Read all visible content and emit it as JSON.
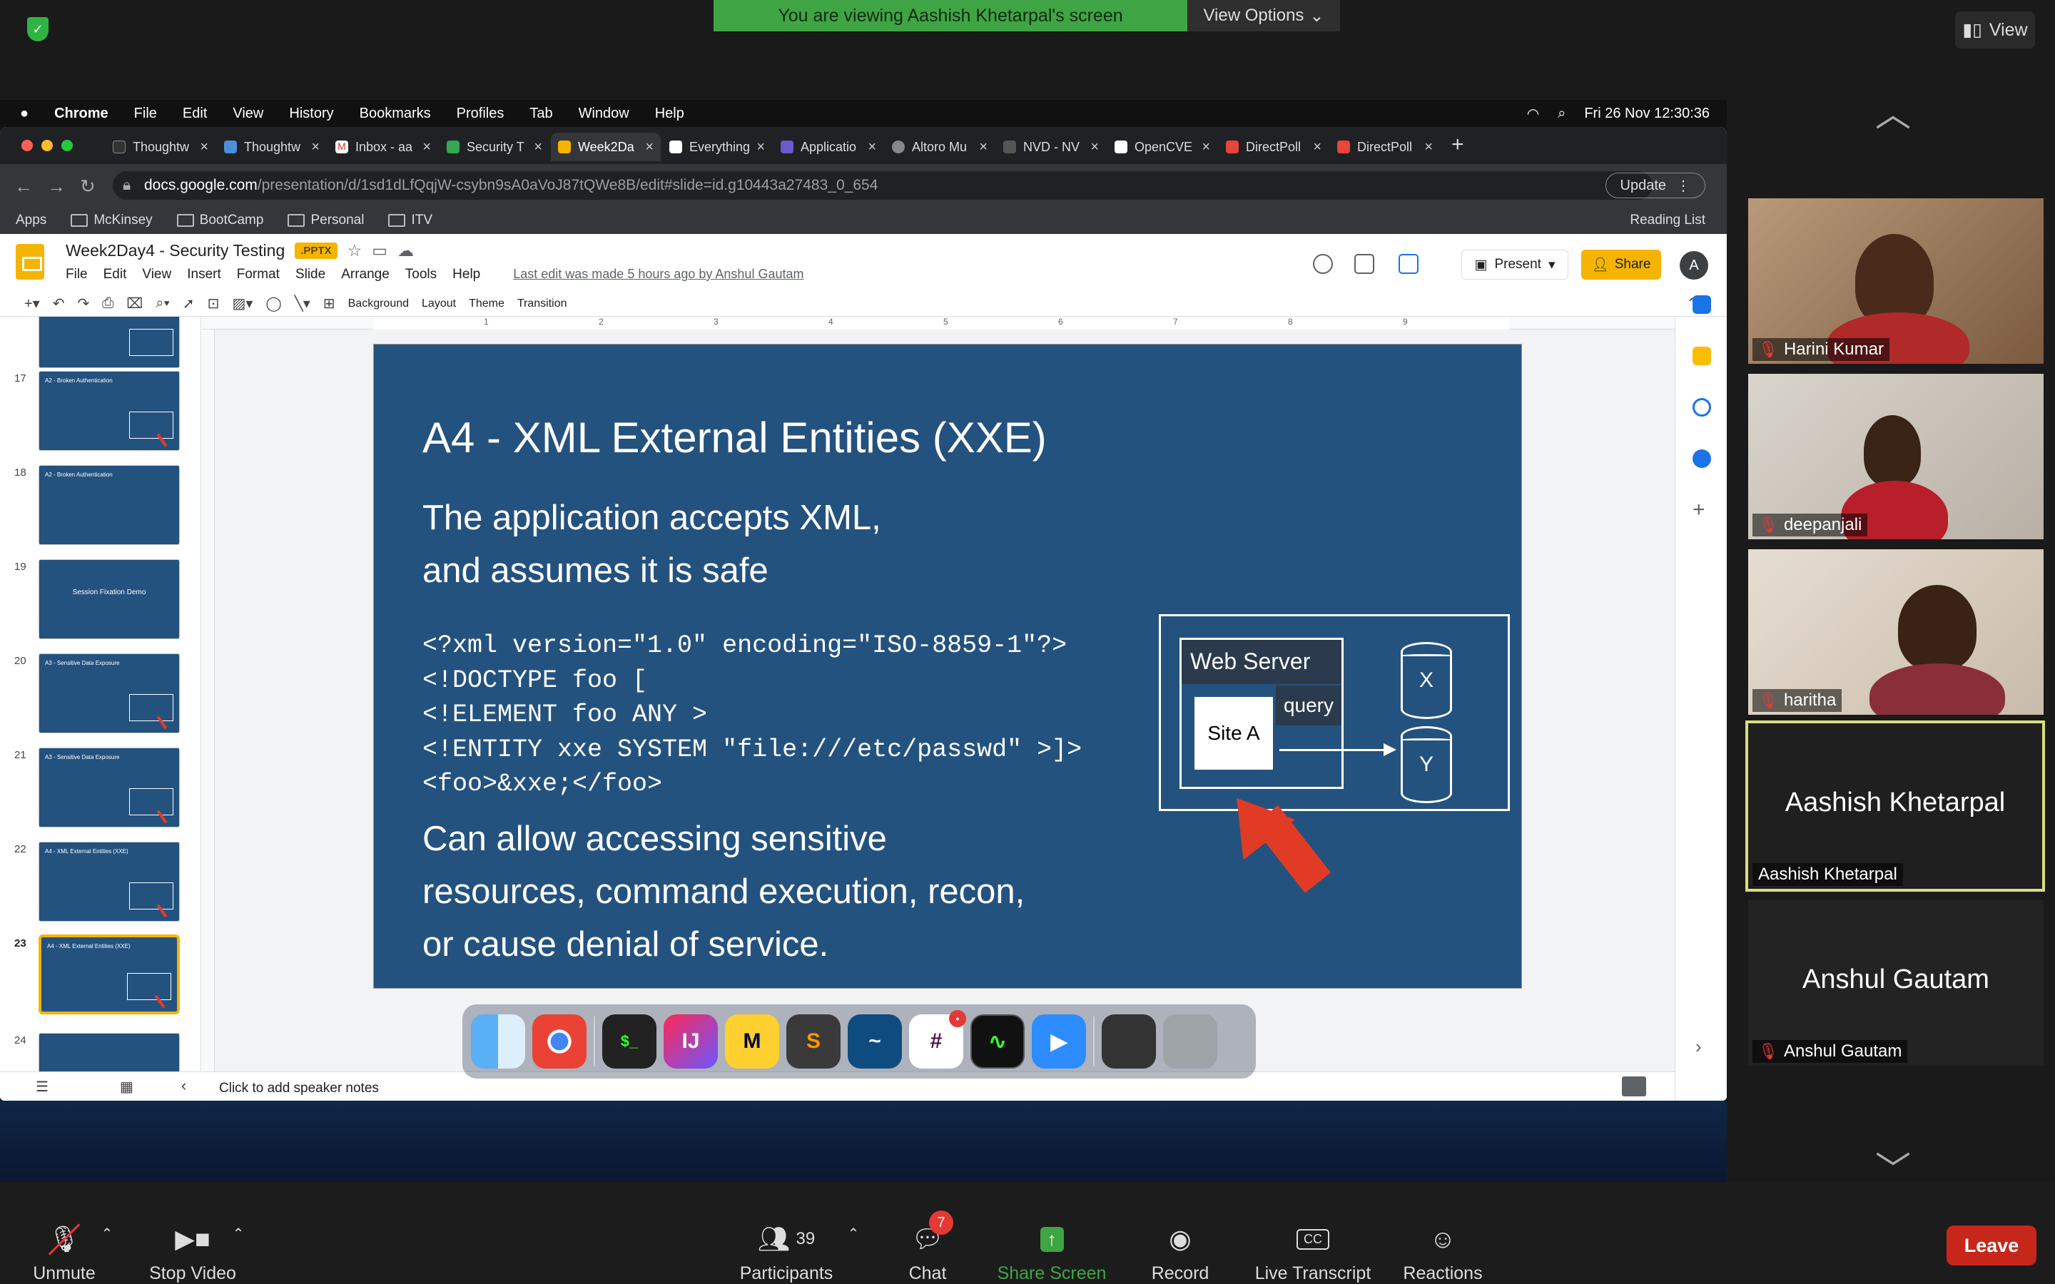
{
  "zoom": {
    "banner": "You are viewing Aashish Khetarpal's screen",
    "view_options": "View Options",
    "view": "View",
    "bottom": {
      "unmute": "Unmute",
      "stop_video": "Stop Video",
      "participants": "Participants",
      "participants_count": "39",
      "chat": "Chat",
      "chat_badge": "7",
      "share_screen": "Share Screen",
      "record": "Record",
      "live_transcript": "Live Transcript",
      "reactions": "Reactions",
      "leave": "Leave"
    },
    "participants": [
      {
        "name": "Harini Kumar",
        "muted": true
      },
      {
        "name": "deepanjali",
        "muted": true
      },
      {
        "name": "haritha",
        "muted": true
      },
      {
        "name": "Aashish Khetarpal",
        "display": "Aashish Khetarpal",
        "muted": false
      },
      {
        "name": "Anshul Gautam",
        "display": "Anshul Gautam",
        "muted": true
      }
    ]
  },
  "mac": {
    "app": "Chrome",
    "menus": [
      "File",
      "Edit",
      "View",
      "History",
      "Bookmarks",
      "Profiles",
      "Tab",
      "Window",
      "Help"
    ],
    "clock": "Fri 26 Nov  12:30:36"
  },
  "chrome": {
    "tabs": [
      "Thoughtw",
      "Thoughtw",
      "Inbox - aa",
      "Security T",
      "Week2Da",
      "Everything",
      "Applicatio",
      "Altoro Mu",
      "NVD - NV",
      "OpenCVE",
      "DirectPoll",
      "DirectPoll"
    ],
    "url_host": "docs.google.com",
    "url_path": "/presentation/d/1sd1dLfQqjW-csybn9sA0aVoJ87tQWe8B/edit#slide=id.g10443a27483_0_654",
    "update": "Update",
    "bookmarks": [
      "Apps",
      "McKinsey",
      "BootCamp",
      "Personal",
      "ITV"
    ],
    "reading_list": "Reading List"
  },
  "slides": {
    "title": "Week2Day4 - Security Testing",
    "badge": ".PPTX",
    "menus": [
      "File",
      "Edit",
      "View",
      "Insert",
      "Format",
      "Slide",
      "Arrange",
      "Tools",
      "Help"
    ],
    "last_edit": "Last edit was made 5 hours ago by Anshul Gautam",
    "present": "Present",
    "share": "Share",
    "account": "A",
    "toolbar": {
      "background": "Background",
      "layout": "Layout",
      "theme": "Theme",
      "transition": "Transition"
    },
    "ruler": [
      "1",
      "2",
      "3",
      "4",
      "5",
      "6",
      "7",
      "8",
      "9"
    ],
    "speaker_notes": "Click to add speaker notes",
    "thumbs": [
      {
        "num": "17",
        "title": "A2 - Broken Authentication"
      },
      {
        "num": "18",
        "title": "A2 - Broken Authentication"
      },
      {
        "num": "19",
        "title": "Session Fixation Demo"
      },
      {
        "num": "20",
        "title": "A3 - Sensitive Data Exposure"
      },
      {
        "num": "21",
        "title": "A3 - Sensitive Data Exposure"
      },
      {
        "num": "22",
        "title": "A4 - XML External Entities (XXE)"
      },
      {
        "num": "23",
        "title": "A4 - XML External Entities (XXE)"
      },
      {
        "num": "24",
        "title": ""
      }
    ],
    "current_slide": {
      "title": "A4 - XML External Entities (XXE)",
      "subtitle": "The application accepts XML,\nand assumes it is safe",
      "code": [
        "<?xml version=\"1.0\" encoding=\"ISO-8859-1\"?>",
        "<!DOCTYPE foo [",
        "<!ELEMENT foo ANY >",
        "<!ENTITY xxe SYSTEM \"file:///etc/passwd\" >]>",
        "<foo>&xxe;</foo>"
      ],
      "footer": "Can allow accessing sensitive\nresources,  command execution, recon,\nor cause  denial of service.",
      "diagram": {
        "web_server": "Web Server",
        "site": "Site A",
        "query": "query",
        "db_x": "X",
        "db_y": "Y"
      }
    }
  }
}
